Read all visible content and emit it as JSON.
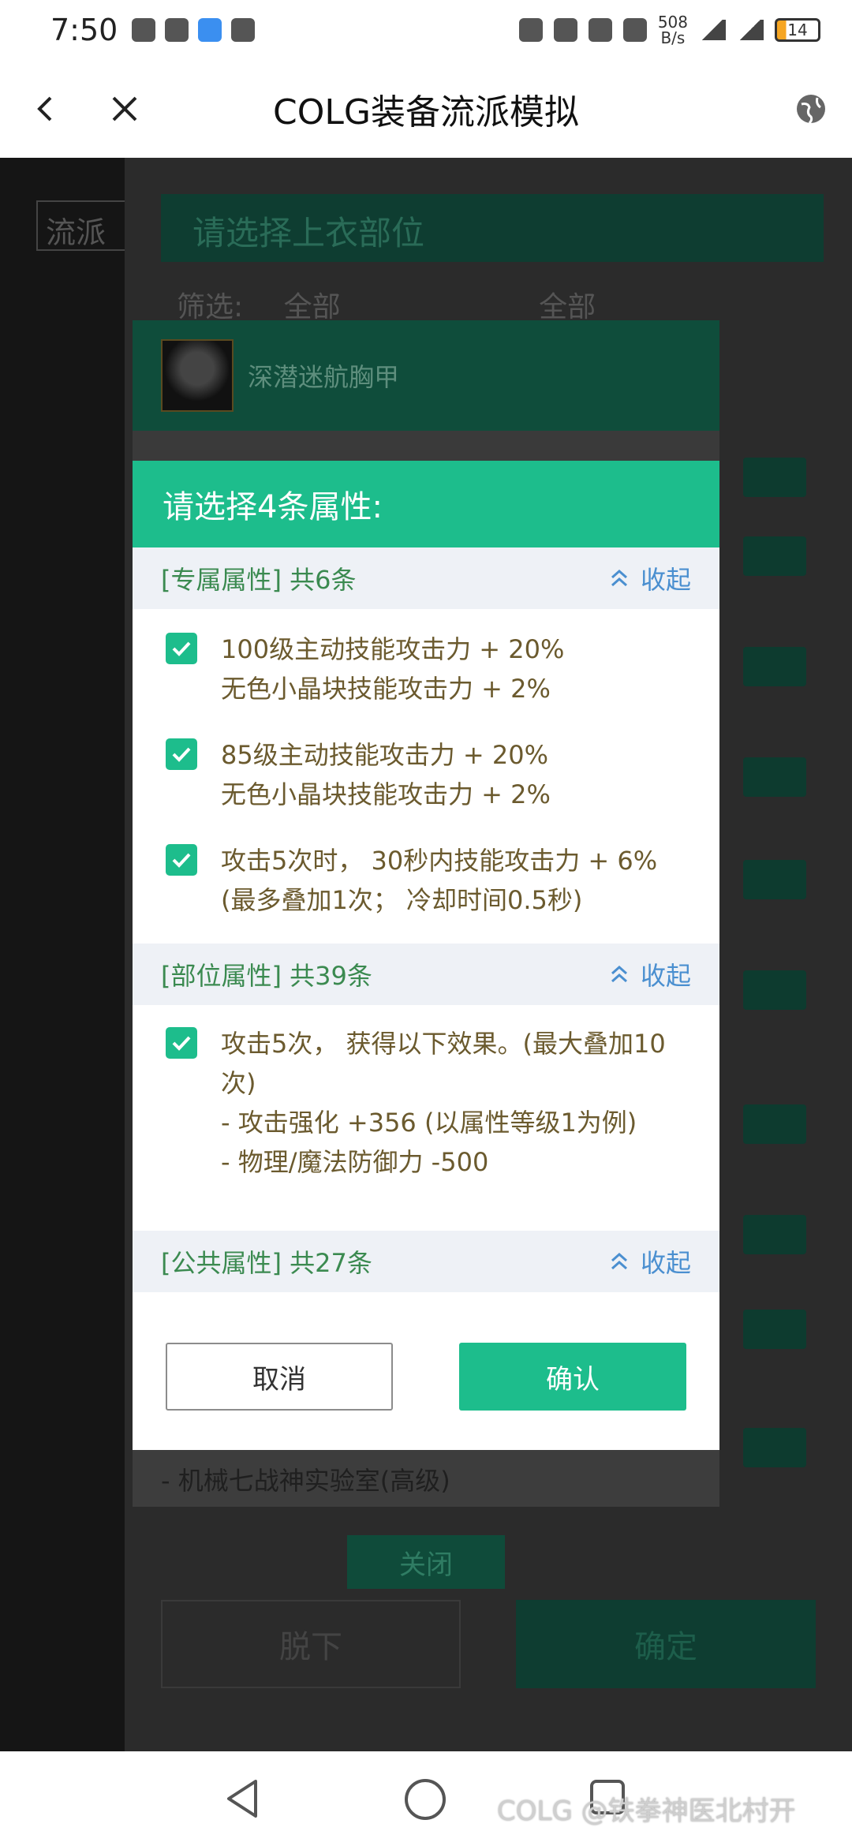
{
  "status_bar": {
    "time": "7:50",
    "net_speed_value": "508",
    "net_speed_unit": "B/s",
    "battery": "14"
  },
  "title_bar": {
    "title": "COLG装备流派模拟"
  },
  "background": {
    "left_tab": "流派",
    "header": "请选择上衣部位",
    "filter_label": "筛选:",
    "filter_value_1": "全部",
    "filter_value_2": "全部",
    "item_name": "深潜迷航胸甲",
    "bottom_line": "- 机械七战神实验室(高级)",
    "close_label": "关闭",
    "unequip_label": "脱下",
    "confirm_label": "确定"
  },
  "dialog": {
    "title": "请选择4条属性:",
    "sections": [
      {
        "title": "[专属属性] 共6条",
        "collapse_label": "收起",
        "options": [
          {
            "checked": true,
            "lines": [
              "100级主动技能攻击力 + 20%",
              "无色小晶块技能攻击力 + 2%"
            ]
          },
          {
            "checked": true,
            "lines": [
              "85级主动技能攻击力 + 20%",
              "无色小晶块技能攻击力 + 2%"
            ]
          },
          {
            "checked": true,
            "lines": [
              "攻击5次时， 30秒内技能攻击力 + 6%",
              "(最多叠加1次； 冷却时间0.5秒)"
            ]
          }
        ]
      },
      {
        "title": "[部位属性] 共39条",
        "collapse_label": "收起",
        "options": [
          {
            "checked": true,
            "lines": [
              "攻击5次， 获得以下效果。(最大叠加10",
              "次)",
              "- 攻击强化 +356 (以属性等级1为例)",
              "- 物理/魔法防御力 -500"
            ]
          }
        ]
      },
      {
        "title": "[公共属性] 共27条",
        "collapse_label": "收起",
        "options": []
      }
    ],
    "cancel_label": "取消",
    "ok_label": "确认"
  },
  "watermark": "COLG @铁拳神医北村开",
  "colors": {
    "accent": "#1dbd8c",
    "section_title": "#3b8a50",
    "link": "#4a8fd0",
    "option_text": "#6b5a2e"
  }
}
